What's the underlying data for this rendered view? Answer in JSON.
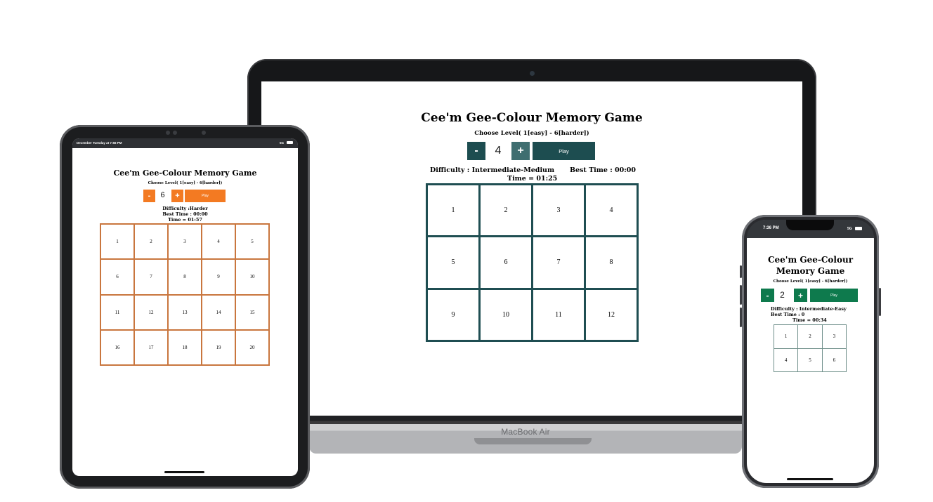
{
  "colors": {
    "laptop_accent": "#1d4d50",
    "tablet_accent": "#f37a22",
    "phone_accent": "#0e7a4d"
  },
  "laptop": {
    "brand": "MacBook Air",
    "game": {
      "title": "Cee'm Gee-Colour Memory Game",
      "choose_level": "Choose Level( 1[easy] - 6[harder])",
      "minus_label": "-",
      "level_value": "4",
      "plus_label": "+",
      "play_label": "Play",
      "difficulty": "Difficulty : Intermediate-Medium",
      "best_time": "Best Time : 00:00",
      "time": "Time = 01:25",
      "cells": [
        "1",
        "2",
        "3",
        "4",
        "5",
        "6",
        "7",
        "8",
        "9",
        "10",
        "11",
        "12"
      ]
    }
  },
  "tablet": {
    "status_left": "December Tuesday at 7:56 PM",
    "status_right": "5G",
    "game": {
      "title": "Cee'm Gee-Colour Memory Game",
      "choose_level": "Choose Level( 1[easy] - 6[harder])",
      "minus_label": "-",
      "level_value": "6",
      "plus_label": "+",
      "play_label": "Play",
      "difficulty": "Difficulty :Harder",
      "best_time": "Best Time : 00:00",
      "time": "Time = 01:57",
      "cells": [
        "1",
        "2",
        "3",
        "4",
        "5",
        "6",
        "7",
        "8",
        "9",
        "10",
        "11",
        "12",
        "13",
        "14",
        "15",
        "16",
        "17",
        "18",
        "19",
        "20"
      ]
    }
  },
  "phone": {
    "status_time": "7:36 PM",
    "status_right": "5G",
    "game": {
      "title_line1": "Cee'm Gee-Colour",
      "title_line2": "Memory Game",
      "choose_level": "Choose Level( 1[easy] - 6[harder])",
      "minus_label": "-",
      "level_value": "2",
      "plus_label": "+",
      "play_label": "Play",
      "difficulty": "Difficulty : Intermediate-Easy",
      "best_time": "Best Time : 0",
      "time": "Time = 00:34",
      "cells": [
        "1",
        "2",
        "3",
        "4",
        "5",
        "6"
      ]
    }
  }
}
